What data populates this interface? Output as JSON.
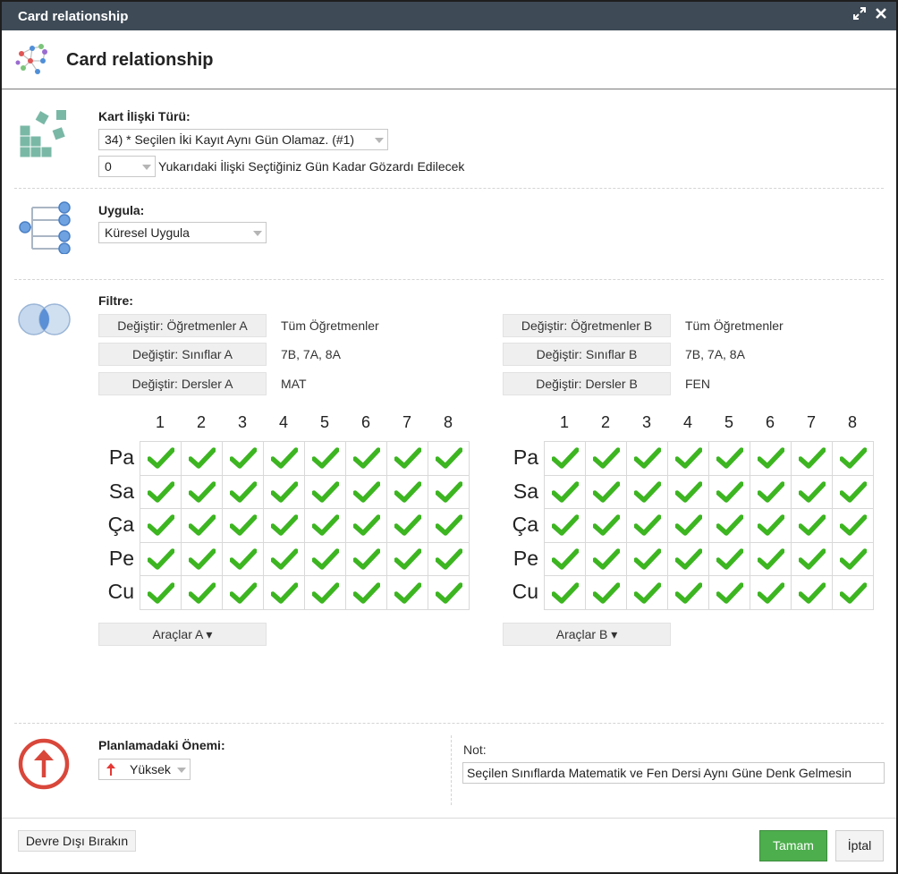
{
  "window": {
    "title": "Card relationship",
    "header_title": "Card relationship"
  },
  "relation_type": {
    "label": "Kart İlişki Türü:",
    "selected": "34) * Seçilen İki Kayıt Aynı Gün Olamaz. (#1)",
    "ignore_value": "0",
    "ignore_text": "Yukarıdaki İlişki Seçtiğiniz Gün Kadar Gözardı Edilecek"
  },
  "apply": {
    "label": "Uygula:",
    "selected": "Küresel Uygula"
  },
  "filter": {
    "label": "Filtre:",
    "a": {
      "teachers_button": "Değiştir: Öğretmenler A",
      "teachers_value": "Tüm Öğretmenler",
      "classes_button": "Değiştir: Sınıflar A",
      "classes_value": "7B, 7A, 8A",
      "subjects_button": "Değiştir: Dersler A",
      "subjects_value": "MAT",
      "tools_button": "Araçlar A ▾"
    },
    "b": {
      "teachers_button": "Değiştir: Öğretmenler B",
      "teachers_value": "Tüm Öğretmenler",
      "classes_button": "Değiştir: Sınıflar B",
      "classes_value": "7B, 7A, 8A",
      "subjects_button": "Değiştir: Dersler B",
      "subjects_value": "FEN",
      "tools_button": "Araçlar B ▾"
    }
  },
  "grid": {
    "periods": [
      "1",
      "2",
      "3",
      "4",
      "5",
      "6",
      "7",
      "8"
    ],
    "days": [
      "Pa",
      "Sa",
      "Ça",
      "Pe",
      "Cu"
    ],
    "checked_color": "#3cb521"
  },
  "importance": {
    "label": "Planlamadaki Önemi:",
    "selected": "Yüksek",
    "arrow_color": "#e53935",
    "icon_color": "#d9473b"
  },
  "note": {
    "label": "Not:",
    "value": "Seçilen Sınıflarda Matematik ve Fen Dersi Aynı Güne Denk Gelmesin"
  },
  "footer": {
    "disable_button": "Devre Dışı Bırakın",
    "ok_button": "Tamam",
    "cancel_button": "İptal"
  },
  "icons": {
    "maximize": "maximize-icon",
    "close": "close-icon",
    "relationship": "card-relationship-icon",
    "relation_type": "relation-type-icon",
    "apply": "apply-tree-icon",
    "filter": "filter-venn-icon",
    "importance": "importance-up-arrow-icon",
    "check": "checkmark-icon"
  }
}
